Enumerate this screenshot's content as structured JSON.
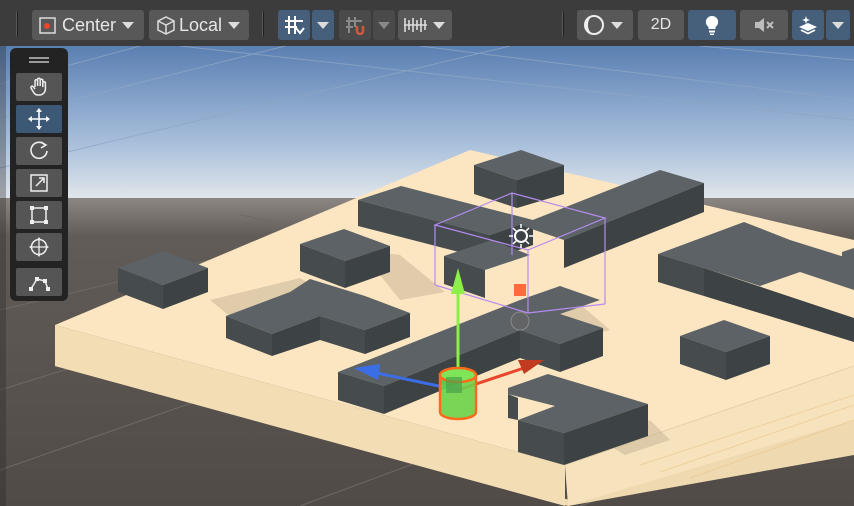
{
  "toolbar": {
    "pivot_mode_label": "Center",
    "pivot_rotation_label": "Local",
    "two_d_label": "2D"
  },
  "tools": [
    {
      "name": "hand-tool",
      "icon": "hand-icon",
      "active": false
    },
    {
      "name": "move-tool",
      "icon": "move-icon",
      "active": true
    },
    {
      "name": "rotate-tool",
      "icon": "rotate-icon",
      "active": false
    },
    {
      "name": "scale-tool",
      "icon": "scale-icon",
      "active": false
    },
    {
      "name": "rect-tool",
      "icon": "rect-icon",
      "active": false
    },
    {
      "name": "transform-tool",
      "icon": "transform-icon",
      "active": false
    },
    {
      "name": "custom-editor-tool",
      "icon": "custom-tool-icon",
      "active": false
    }
  ],
  "colors": {
    "toolbar_bg": "#3c3c3c",
    "button_bg": "#585858",
    "active_button_bg": "#46607c",
    "sky_top": "#5f84b6",
    "horizon": "#e8e9ea",
    "ground": "#55504c",
    "platform_top": "#fde7c3",
    "platform_side": "#efd8b0",
    "block_top": "#5a6063",
    "x_axis": "#e8452a",
    "y_axis": "#8df04a",
    "z_axis": "#3b6ee6",
    "selection_outline": "#b48cf0"
  }
}
